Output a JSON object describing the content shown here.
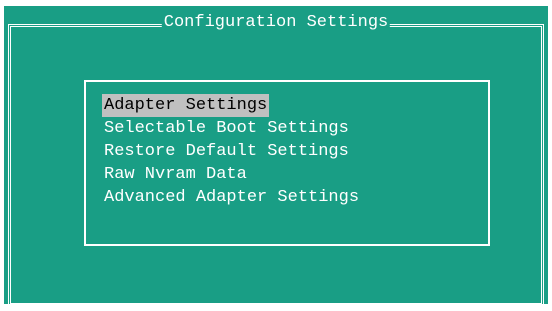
{
  "window": {
    "title": "Configuration Settings"
  },
  "menu": {
    "items": [
      {
        "label": "Adapter Settings",
        "selected": true
      },
      {
        "label": "Selectable Boot Settings",
        "selected": false
      },
      {
        "label": "Restore Default Settings",
        "selected": false
      },
      {
        "label": "Raw Nvram Data",
        "selected": false
      },
      {
        "label": "Advanced Adapter Settings",
        "selected": false
      }
    ]
  },
  "colors": {
    "background": "#199e85",
    "text": "#ffffff",
    "highlight_bg": "#c0c0c0",
    "highlight_text": "#000000"
  }
}
